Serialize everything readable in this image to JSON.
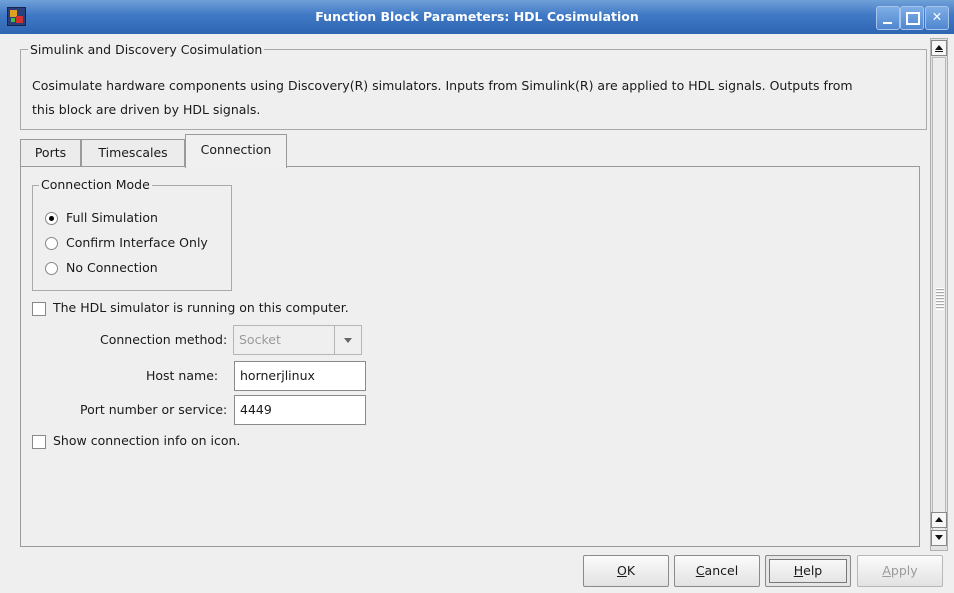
{
  "window": {
    "title": "Function Block Parameters: HDL Cosimulation"
  },
  "group": {
    "legend": "Simulink and Discovery Cosimulation",
    "description_line1": "Cosimulate hardware components using Discovery(R) simulators.  Inputs from Simulink(R) are applied to HDL signals.  Outputs from",
    "description_line2": "this block are driven by HDL signals."
  },
  "tabs": [
    {
      "label": "Ports",
      "active": false
    },
    {
      "label": "Timescales",
      "active": false
    },
    {
      "label": "Connection",
      "active": true
    }
  ],
  "connection_mode": {
    "legend": "Connection Mode",
    "options": [
      {
        "label": "Full Simulation",
        "selected": true
      },
      {
        "label": "Confirm Interface Only",
        "selected": false
      },
      {
        "label": "No Connection",
        "selected": false
      }
    ]
  },
  "running_local": {
    "label": "The HDL simulator is running on this computer.",
    "checked": false
  },
  "connection_method": {
    "label": "Connection method:",
    "value": "Socket",
    "disabled": true
  },
  "host_name": {
    "label": "Host name:",
    "value": "hornerjlinux"
  },
  "port": {
    "label": "Port number or service:",
    "value": "4449"
  },
  "show_info": {
    "label": "Show connection info on icon.",
    "checked": false
  },
  "buttons": {
    "ok": "OK",
    "cancel": "Cancel",
    "help": "Help",
    "apply": "Apply"
  },
  "colors": {
    "titlebar": "#3f78c4",
    "background": "#efefef"
  }
}
